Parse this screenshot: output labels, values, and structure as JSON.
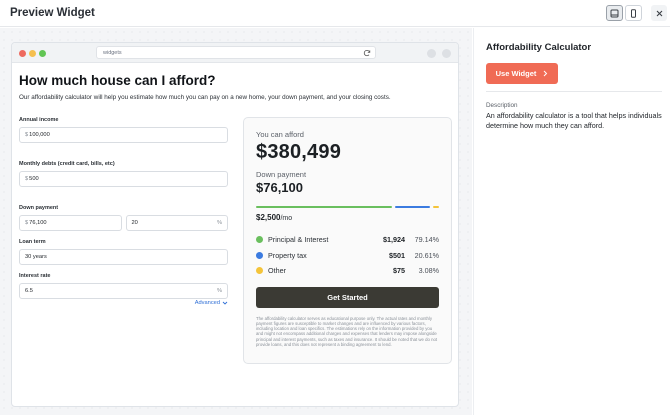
{
  "header": {
    "title": "Preview Widget"
  },
  "browser": {
    "url": "widgets"
  },
  "calculator": {
    "title": "How much house can I afford?",
    "subtitle": "Our affordability calculator will help you estimate how much you can pay on a new home, your down payment, and your closing costs.",
    "annual_income": {
      "label": "Annual income",
      "prefix": "$",
      "value": "100,000"
    },
    "monthly_debts": {
      "label": "Monthly debts (credit card, bills, etc)",
      "prefix": "$",
      "value": "500"
    },
    "down_payment": {
      "label": "Down payment",
      "prefix": "$",
      "value": "76,100",
      "percent": "20",
      "suffix": "%"
    },
    "loan_term": {
      "label": "Loan term",
      "value": "30 years"
    },
    "interest_rate": {
      "label": "Interest rate",
      "value": "6.5",
      "suffix": "%"
    },
    "advanced_label": "Advanced"
  },
  "result": {
    "afford_label": "You can afford",
    "afford_value": "$380,499",
    "down_label": "Down payment",
    "down_value": "$76,100",
    "monthly_value": "$2,500",
    "monthly_unit": "/mo",
    "breakdown": [
      {
        "name": "Principal & Interest",
        "amount": "$1,924",
        "percent": "79.14%",
        "share": 0.7914,
        "color": "#6abf5e"
      },
      {
        "name": "Property tax",
        "amount": "$501",
        "percent": "20.61%",
        "share": 0.2061,
        "color": "#3b7be0"
      },
      {
        "name": "Other",
        "amount": "$75",
        "percent": "3.08%",
        "share": 0.0308,
        "color": "#f4c43a"
      }
    ],
    "cta_label": "Get Started",
    "disclaimer": "The affordability calculator serves as educational purpose only. The actual rates and monthly payment figures are susceptible to market changes and are influenced by various factors, including location and loan specifics. The estimations rely on the information provided by you and might not encompass additional charges and expenses that lenders may impose alongside principal and interest payments, such as taxes and insurance. It should be noted that we do not provide loans, and this does not represent a binding agreement to lend."
  },
  "panel": {
    "title": "Affordability Calculator",
    "use_label": "Use Widget",
    "desc_label": "Description",
    "description": "An affordability calculator is a tool that helps individuals determine how much they can afford."
  },
  "colors": {
    "accent": "#f06b55",
    "cta": "#3b3a34",
    "link": "#2f6fd6"
  }
}
